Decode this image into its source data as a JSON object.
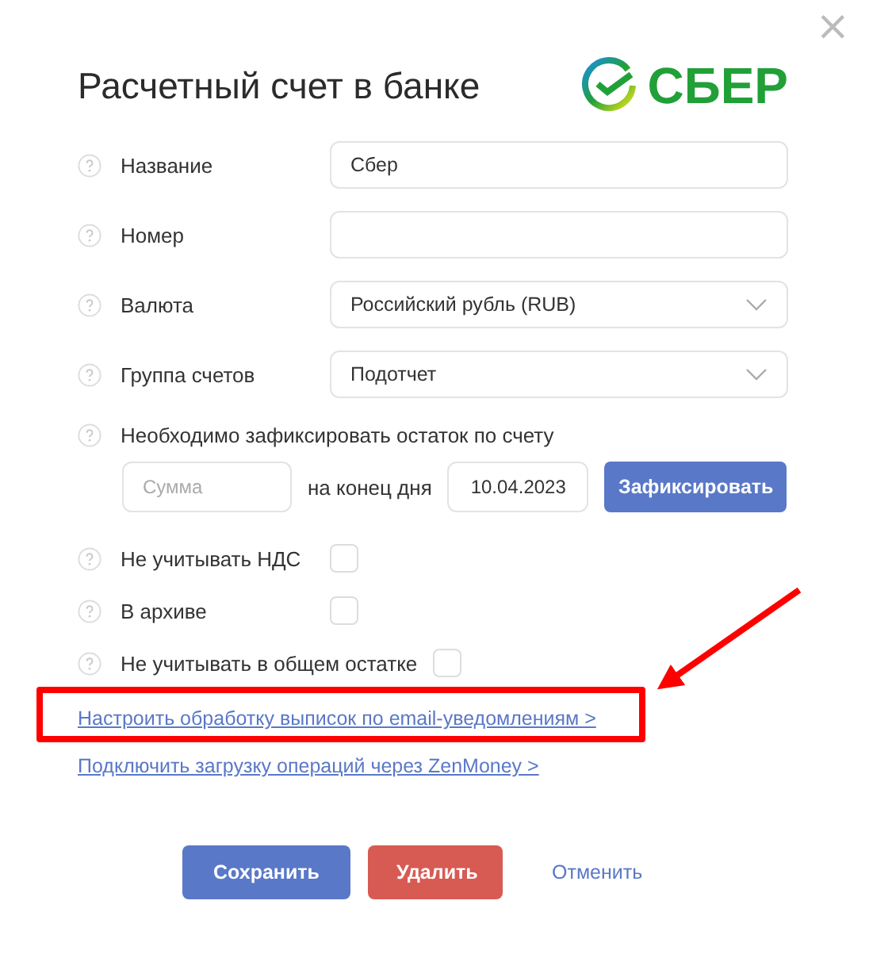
{
  "dialog": {
    "title": "Расчетный счет в банке",
    "logo_text": "СБЕР",
    "close": "×"
  },
  "fields": [
    {
      "kind": "text",
      "label": "Название",
      "value": "Сбер"
    },
    {
      "kind": "text",
      "label": "Номер"
    },
    {
      "kind": "select",
      "label": "Валюта",
      "value": "Российский рубль (RUB)"
    },
    {
      "kind": "select",
      "label": "Группа счетов",
      "value": "Подотчет"
    }
  ],
  "balance": {
    "label": "Необходимо зафиксировать остаток по счету",
    "amount_placeholder": "Сумма",
    "date_label": "на конец дня",
    "date": "10.04.2023",
    "button": "Зафиксировать"
  },
  "checkboxes": [
    {
      "label": "Не учитывать НДС",
      "checked": false
    },
    {
      "label": "В архиве",
      "checked": false
    },
    {
      "label": "Не учитывать в общем остатке",
      "checked": false
    }
  ],
  "links": [
    {
      "text": "Настроить обработку выписок по email-уведомлениям >",
      "highlighted": true
    },
    {
      "text": "Подключить загрузку операций через ZenMoney >",
      "highlighted": false
    }
  ],
  "buttons": [
    {
      "kind": "primary",
      "label": "Сохранить"
    },
    {
      "kind": "danger",
      "label": "Удалить"
    },
    {
      "kind": "plain",
      "label": "Отменить"
    }
  ]
}
